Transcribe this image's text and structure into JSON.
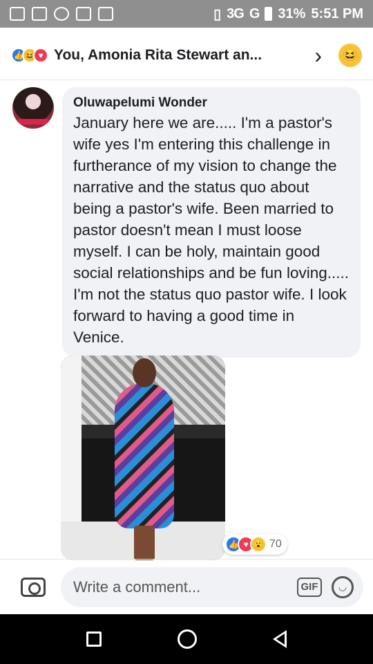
{
  "status_bar": {
    "network": "3G",
    "network2": "G",
    "battery": "31%",
    "time": "5:51 PM"
  },
  "header": {
    "reactors_text": "You, Amonia Rita Stewart an...",
    "reactions": [
      "like-icon",
      "haha-icon",
      "love-icon"
    ],
    "chevron": "›"
  },
  "comment": {
    "author": "Oluwapelumi Wonder",
    "text": "January here we are..... I'm a pastor's wife yes I'm entering this challenge in furtherance of my vision to change the narrative and the status quo about being a pastor's wife. Been married to pastor doesn't mean I must loose myself. I can be holy, maintain good social relationships and be fun loving..... I'm not the status quo pastor wife. I look forward to having a good time in Venice.",
    "reaction_count": "70",
    "reaction_icons": [
      "like-icon",
      "love-icon",
      "wow-icon"
    ]
  },
  "composer": {
    "placeholder": "Write a comment...",
    "gif_label": "GIF"
  },
  "colors": {
    "like": "#2b78f0",
    "love": "#f03a52",
    "haha": "#f7c33b",
    "bubble": "#f0f2f5"
  }
}
